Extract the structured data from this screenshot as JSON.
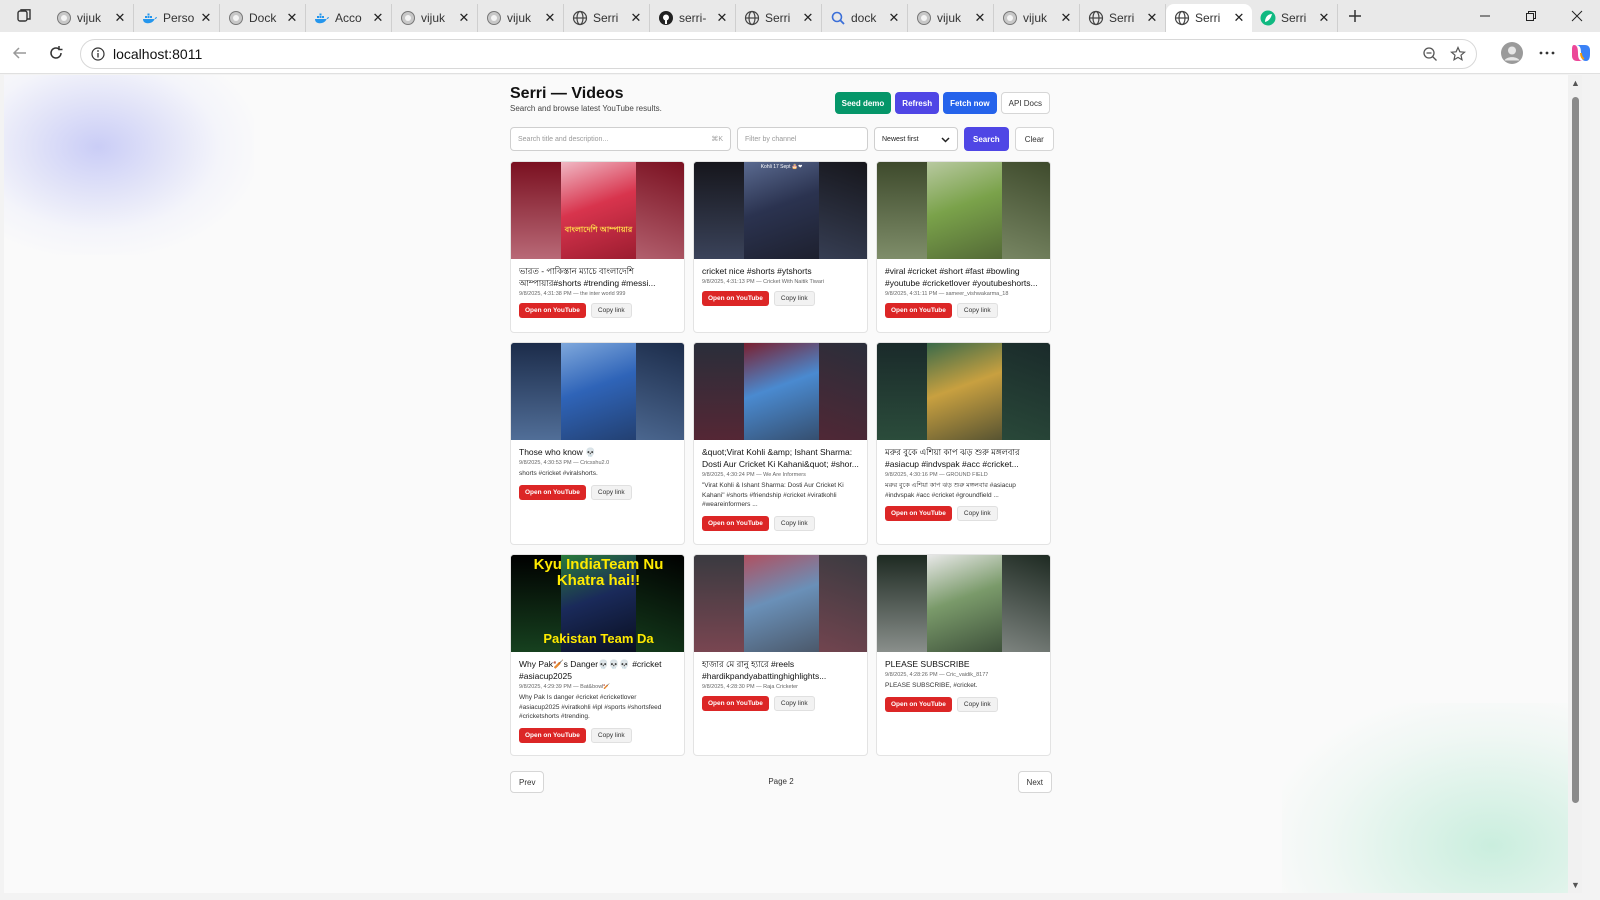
{
  "browser": {
    "tabs": [
      {
        "title": "vijuk",
        "icon": "circle-icon"
      },
      {
        "title": "Perso",
        "icon": "docker-icon"
      },
      {
        "title": "Dock",
        "icon": "circle-icon"
      },
      {
        "title": "Acco",
        "icon": "docker-icon"
      },
      {
        "title": "vijuk",
        "icon": "circle-icon"
      },
      {
        "title": "vijuk",
        "icon": "circle-icon"
      },
      {
        "title": "Serri",
        "icon": "globe-icon"
      },
      {
        "title": "serri-",
        "icon": "github-icon"
      },
      {
        "title": "Serri",
        "icon": "globe-icon"
      },
      {
        "title": "dock",
        "icon": "search-icon"
      },
      {
        "title": "vijuk",
        "icon": "circle-icon"
      },
      {
        "title": "vijuk",
        "icon": "circle-icon"
      },
      {
        "title": "Serri",
        "icon": "globe-icon"
      },
      {
        "title": "Serri",
        "icon": "globe-icon",
        "active": true
      },
      {
        "title": "Serri",
        "icon": "feather-icon"
      }
    ],
    "url": "localhost:8011"
  },
  "header": {
    "title": "Serri — Videos",
    "subtitle": "Search and browse latest YouTube results.",
    "seed_label": "Seed demo",
    "refresh_label": "Refresh",
    "fetch_label": "Fetch now",
    "docs_label": "API Docs"
  },
  "search": {
    "query_placeholder": "Search title and description...",
    "shortcut": "⌘K",
    "channel_placeholder": "Filter by channel",
    "sort_value": "Newest first",
    "search_label": "Search",
    "clear_label": "Clear"
  },
  "cards": [
    {
      "title": "ভারত - পাকিস্তান ম্যাচে বাংলাদেশি আম্পায়ার#shorts #trending #messi...",
      "meta": "9/8/2025, 4:31:38 PM — the inter world 999",
      "desc": "",
      "overlay": "বাংলাদেশি আম্পায়ার",
      "colors": {
        "bg": "#7a1020",
        "center": "#d8344d",
        "accent": "#f0b8c4"
      }
    },
    {
      "title": "cricket nice #shorts #ytshorts",
      "meta": "9/8/2025, 4:31:13 PM — Cricket With Naitik Tiwari",
      "desc": "",
      "overlay": "Kohli 17 Sept 🎂❤",
      "colors": {
        "bg": "#16161c",
        "center": "#2b3350",
        "accent": "#5a6a90"
      }
    },
    {
      "title": "#viral #cricket #short #fast #bowling #youtube #cricketlover #youtubeshorts...",
      "meta": "9/8/2025, 4:31:11 PM — sameer_vishwakarma_18",
      "desc": "",
      "overlay": "",
      "colors": {
        "bg": "#3e4a2c",
        "center": "#7aa24a",
        "accent": "#b8c9a0"
      }
    },
    {
      "title": "Those who know 💀",
      "meta": "9/8/2025, 4:30:53 PM — Cricsshu2.0",
      "desc": "shorts #cricket #viralshorts.",
      "overlay": "",
      "colors": {
        "bg": "#1c2c4a",
        "center": "#2f64b8",
        "accent": "#7fa8dc"
      }
    },
    {
      "title": "&quot;Virat Kohli &amp; Ishant Sharma: Dosti Aur Cricket Ki Kahani&quot; #shor...",
      "meta": "9/8/2025, 4:30:24 PM — We Are Informers",
      "desc": "\"Virat Kohli & Ishant Sharma: Dosti Aur Cricket Ki Kahani\" #shorts #friendship #cricket #viratkohli #weareinformers ...",
      "overlay": "",
      "colors": {
        "bg": "#2a2e3a",
        "center": "#4a8ad0",
        "accent": "#7a2030"
      }
    },
    {
      "title": "মরুর বুকে এশিয়া কাপ ঝড় শুরু মঙ্গলবার #asiacup #indvspak #acc #cricket...",
      "meta": "9/8/2025, 4:30:16 PM — GROUND FIELD",
      "desc": "মরুর বুকে এশিয়া কাপ ঝড় শুরু মঙ্গলবার #asiacup #indvspak #acc #cricket #groundfield ...",
      "overlay": "",
      "colors": {
        "bg": "#1a2a2a",
        "center": "#c8a040",
        "accent": "#3a6a4a"
      }
    },
    {
      "title": "Why Pak🏏s Danger💀💀💀 #cricket #asiacup2025",
      "meta": "9/8/2025, 4:29:39 PM — Bat&bowl🏏",
      "desc": "Why Pak Is danger #cricket #cricketlover #asiacup2025 #viratkohli #ipl #sports #shortsfeed #cricketshorts #trending.",
      "overlay": "Kyu IndiaTeam Nu Khatra hai!!",
      "overlay2": "Pakistan Team Da",
      "colors": {
        "bg": "#000000",
        "center": "#1a2a5a",
        "accent": "#2a7a3a"
      }
    },
    {
      "title": "হাজার মে রানু হ্যারে #reels #hardikpandyabattinghighlights...",
      "meta": "9/8/2025, 4:28:30 PM — Raja Cricketer",
      "desc": "",
      "overlay": "",
      "colors": {
        "bg": "#3a3a40",
        "center": "#6a90b8",
        "accent": "#b05060"
      }
    },
    {
      "title": "PLEASE SUBSCRIBE",
      "meta": "9/8/2025, 4:28:26 PM — Cric_vaidik_8177",
      "desc": "PLEASE SUBSCRIBE, #cricket.",
      "overlay": "",
      "colors": {
        "bg": "#1e2a22",
        "center": "#7a9a6a",
        "accent": "#e8e8e8"
      }
    }
  ],
  "card_actions": {
    "open": "Open on YouTube",
    "copy": "Copy link"
  },
  "pager": {
    "prev": "Prev",
    "page": "Page 2",
    "next": "Next"
  }
}
